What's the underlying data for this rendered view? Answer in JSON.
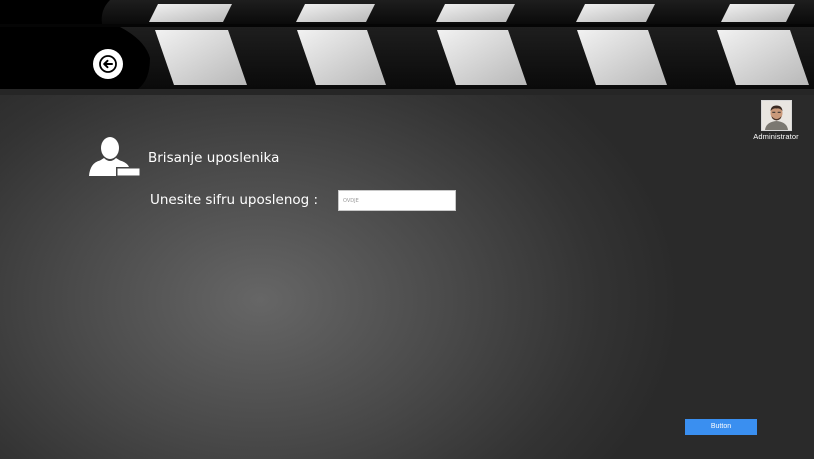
{
  "header": {
    "back_icon": "arrow-left-circle-icon"
  },
  "user": {
    "name": "Administrator",
    "avatar_icon": "user-avatar-photo"
  },
  "section": {
    "icon": "remove-user-icon",
    "title": "Brisanje uposlenika"
  },
  "form": {
    "label": "Unesite sifru uposlenog :",
    "input_value": "",
    "input_placeholder": "OVDJE"
  },
  "actions": {
    "button_label": "Button"
  },
  "colors": {
    "button": "#3a8ff0",
    "background_center": "#666666",
    "background_edge": "#2a2a2a",
    "text": "#ffffff"
  }
}
